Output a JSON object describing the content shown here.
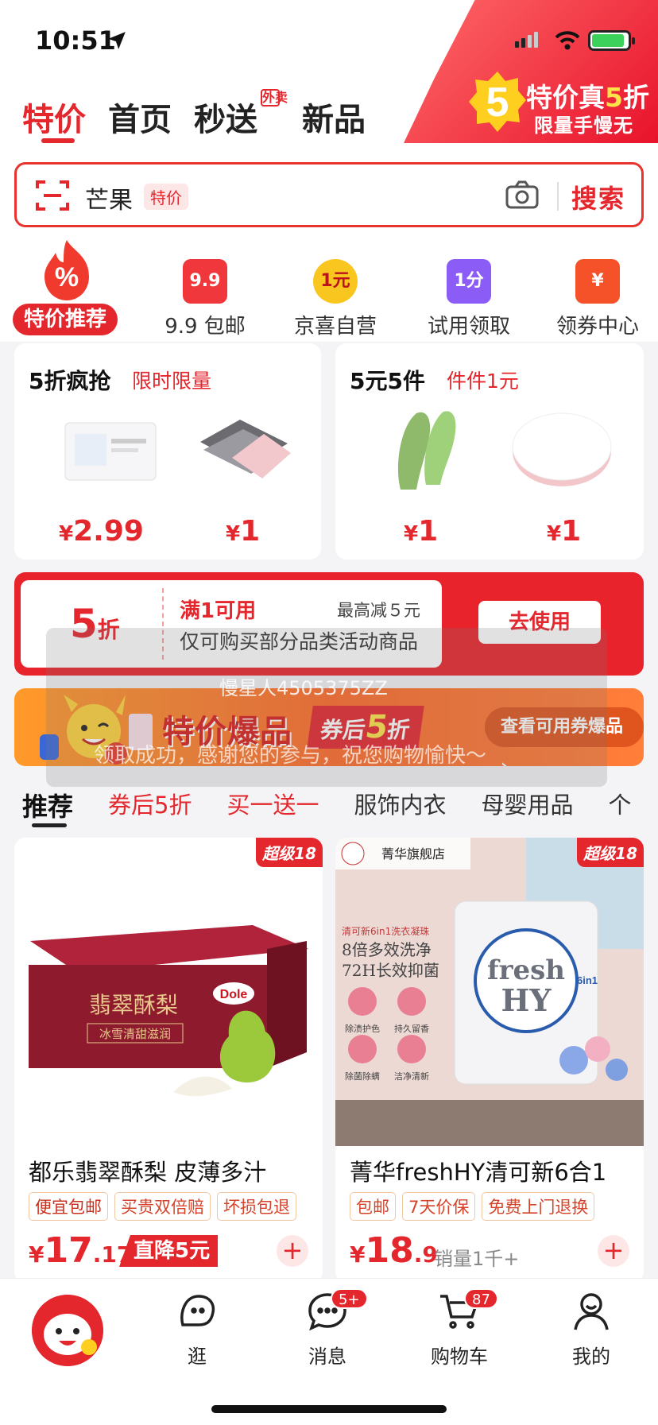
{
  "status": {
    "time": "10:51"
  },
  "promo": {
    "digit": "5",
    "line1_a": "特价真",
    "line1_b": "5",
    "line1_c": "折",
    "line2": "限量手慢无"
  },
  "top_tabs": [
    {
      "label": "特价"
    },
    {
      "label": "首页"
    },
    {
      "label": "秒送",
      "tag": "外卖"
    },
    {
      "label": "新品"
    }
  ],
  "search": {
    "keyword": "芒果",
    "keyword_tag": "特价",
    "button": "搜索"
  },
  "categories": {
    "hot": {
      "label": "特价推荐"
    },
    "items": [
      {
        "label": "9.9 包邮",
        "icon_text": "9.9",
        "icon": "coupon-99-icon",
        "color": "#f0383c"
      },
      {
        "label": "京喜自营",
        "icon_text": "1元",
        "icon": "one-yuan-badge-icon",
        "color": "#f9c51f"
      },
      {
        "label": "试用领取",
        "icon_text": "1分",
        "icon": "trial-bag-icon",
        "color": "#8b5cf6"
      },
      {
        "label": "领券中心",
        "icon_text": "¥",
        "icon": "coupon-center-icon",
        "color": "#f5522a"
      }
    ]
  },
  "deals": [
    {
      "title": "5折疯抢",
      "subtitle": "限时限量",
      "prices": [
        {
          "symbol": "¥",
          "value": "2.99"
        },
        {
          "symbol": "¥",
          "value": "1"
        }
      ]
    },
    {
      "title": "5元5件",
      "subtitle": "件件1元",
      "prices": [
        {
          "symbol": "¥",
          "value": "1"
        },
        {
          "symbol": "¥",
          "value": "1"
        }
      ]
    }
  ],
  "coupon": {
    "discount": "5",
    "unit": "折",
    "condition": "满1可用",
    "max": "最高减５元",
    "desc": "仅可购买部分品类活动商品",
    "button": "去使用"
  },
  "watermark": {
    "user": "慢星人4505375ZZ",
    "msg": "领取成功，感谢您的参与，祝您购物愉快～"
  },
  "banner": {
    "title": "特价爆品",
    "tag_pre": "券后",
    "tag_num": "5",
    "tag_post": "折",
    "button": "查看可用券爆品 ›"
  },
  "feed_tabs": [
    {
      "label": "推荐"
    },
    {
      "label": "券后5折"
    },
    {
      "label": "买一送一"
    },
    {
      "label": "服饰内衣"
    },
    {
      "label": "母婴用品"
    },
    {
      "label": "个"
    }
  ],
  "products": [
    {
      "badge": "超级18",
      "title": "都乐翡翠酥梨 皮薄多汁",
      "tags": [
        "便宜包邮",
        "买贵双倍赔",
        "坏损包退"
      ],
      "price_symbol": "¥",
      "price_int": "17",
      "price_dec": ".17",
      "extra": "直降5元",
      "box_text": "翡翠酥梨",
      "box_sub": "冰雪清甜滋润",
      "brand": "Dole"
    },
    {
      "badge": "超级18",
      "store": "菁华旗舰店",
      "title": "菁华freshHY清可新6合1",
      "tags": [
        "包邮",
        "7天价保",
        "免费上门退换"
      ],
      "price_symbol": "¥",
      "price_int": "18",
      "price_dec": ".9",
      "extra": "销量1千+",
      "img_lines": [
        "清可新6in1洗衣凝珠",
        "8倍多效洗净",
        "72H长效抑菌"
      ],
      "img_features": [
        "除渍护色",
        "持久留香",
        "除菌除螨",
        "洁净清新"
      ],
      "brand_a": "fresh",
      "brand_b": "HY",
      "brand_small": "6in1"
    }
  ],
  "bottom_nav": [
    {
      "label": "逛",
      "icon": "stroll-icon"
    },
    {
      "label": "消息",
      "icon": "message-icon",
      "badge": "5+"
    },
    {
      "label": "购物车",
      "icon": "cart-icon",
      "badge": "87"
    },
    {
      "label": "我的",
      "icon": "profile-icon"
    }
  ],
  "colors": {
    "brand": "#e4262d"
  }
}
